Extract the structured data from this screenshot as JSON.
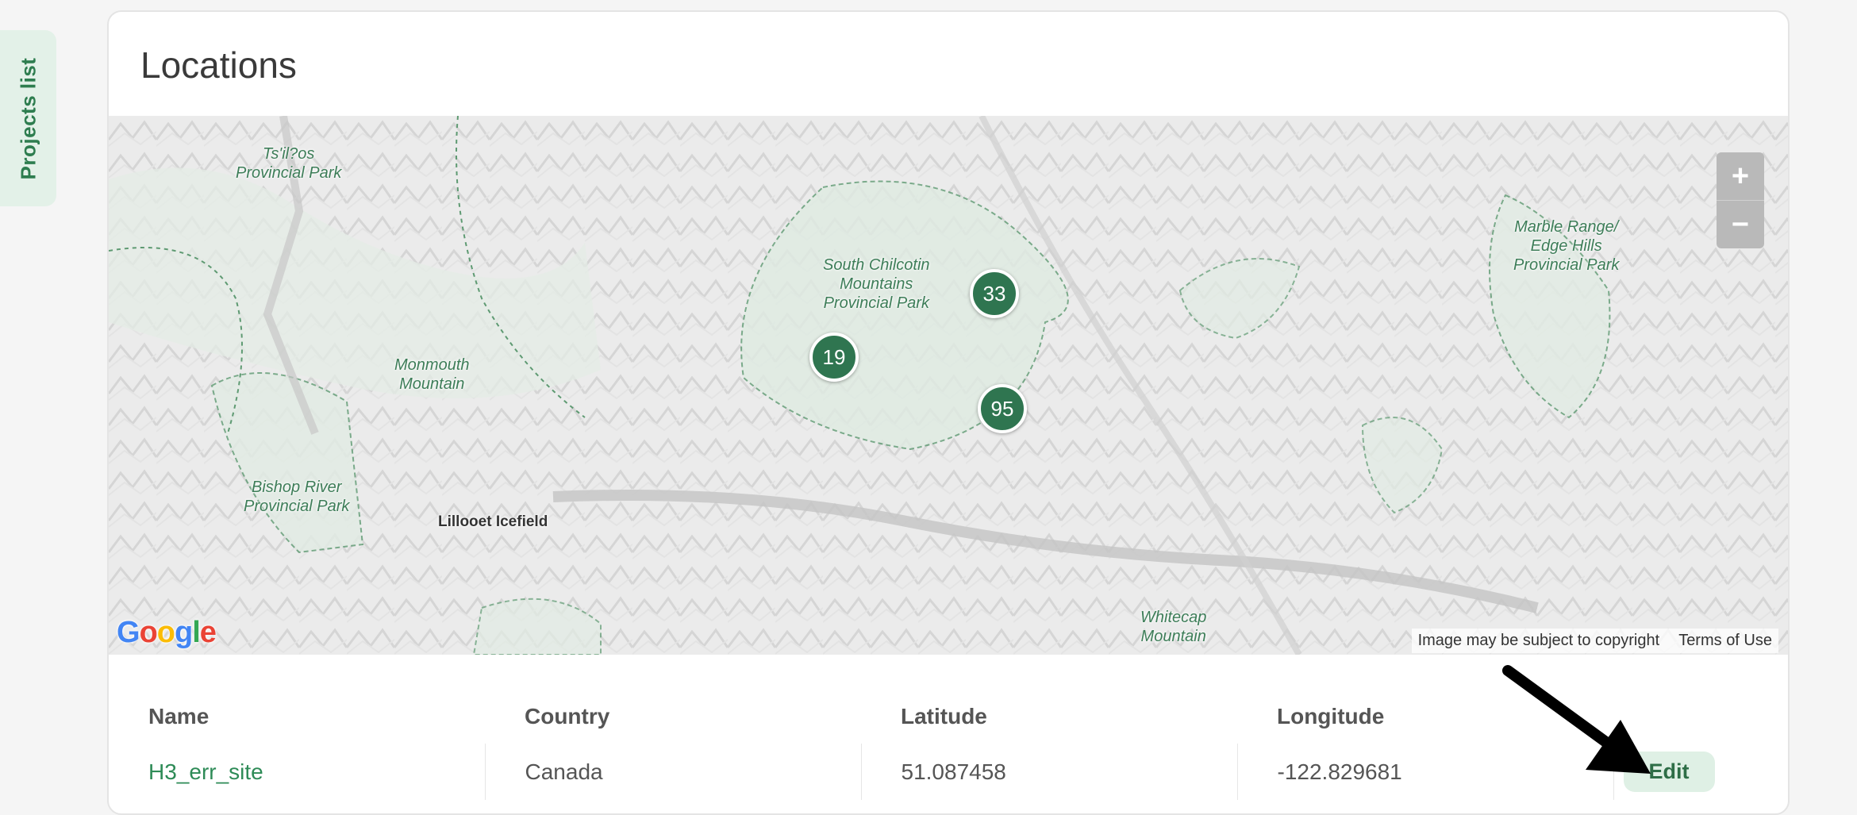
{
  "sidebar": {
    "tab_label": "Projects list"
  },
  "card": {
    "title": "Locations"
  },
  "map": {
    "labels": {
      "tsilos": "Ts'il?os\nProvincial Park",
      "chilcotin": "South Chilcotin\nMountains\nProvincial Park",
      "monmouth": "Monmouth\nMountain",
      "bishop": "Bishop River\nProvincial Park",
      "lillooet": "Lillooet Icefield",
      "marble": "Marble Range/\nEdge Hills\nProvincial Park",
      "whitecap": "Whitecap\nMountain"
    },
    "clusters": {
      "c33": "33",
      "c19": "19",
      "c95": "95"
    },
    "zoom_in": "+",
    "zoom_out": "−",
    "google_logo": "Google",
    "copyright": "Image may be subject to copyright",
    "terms": "Terms of Use"
  },
  "table": {
    "headers": [
      "Name",
      "Country",
      "Latitude",
      "Longitude"
    ],
    "rows": [
      {
        "name": "H3_err_site",
        "country": "Canada",
        "latitude": "51.087458",
        "longitude": "-122.829681",
        "action": "Edit"
      }
    ]
  },
  "colors": {
    "accent": "#2e8b57",
    "cluster": "#2f7550",
    "tab_bg": "#e3f1e8"
  }
}
